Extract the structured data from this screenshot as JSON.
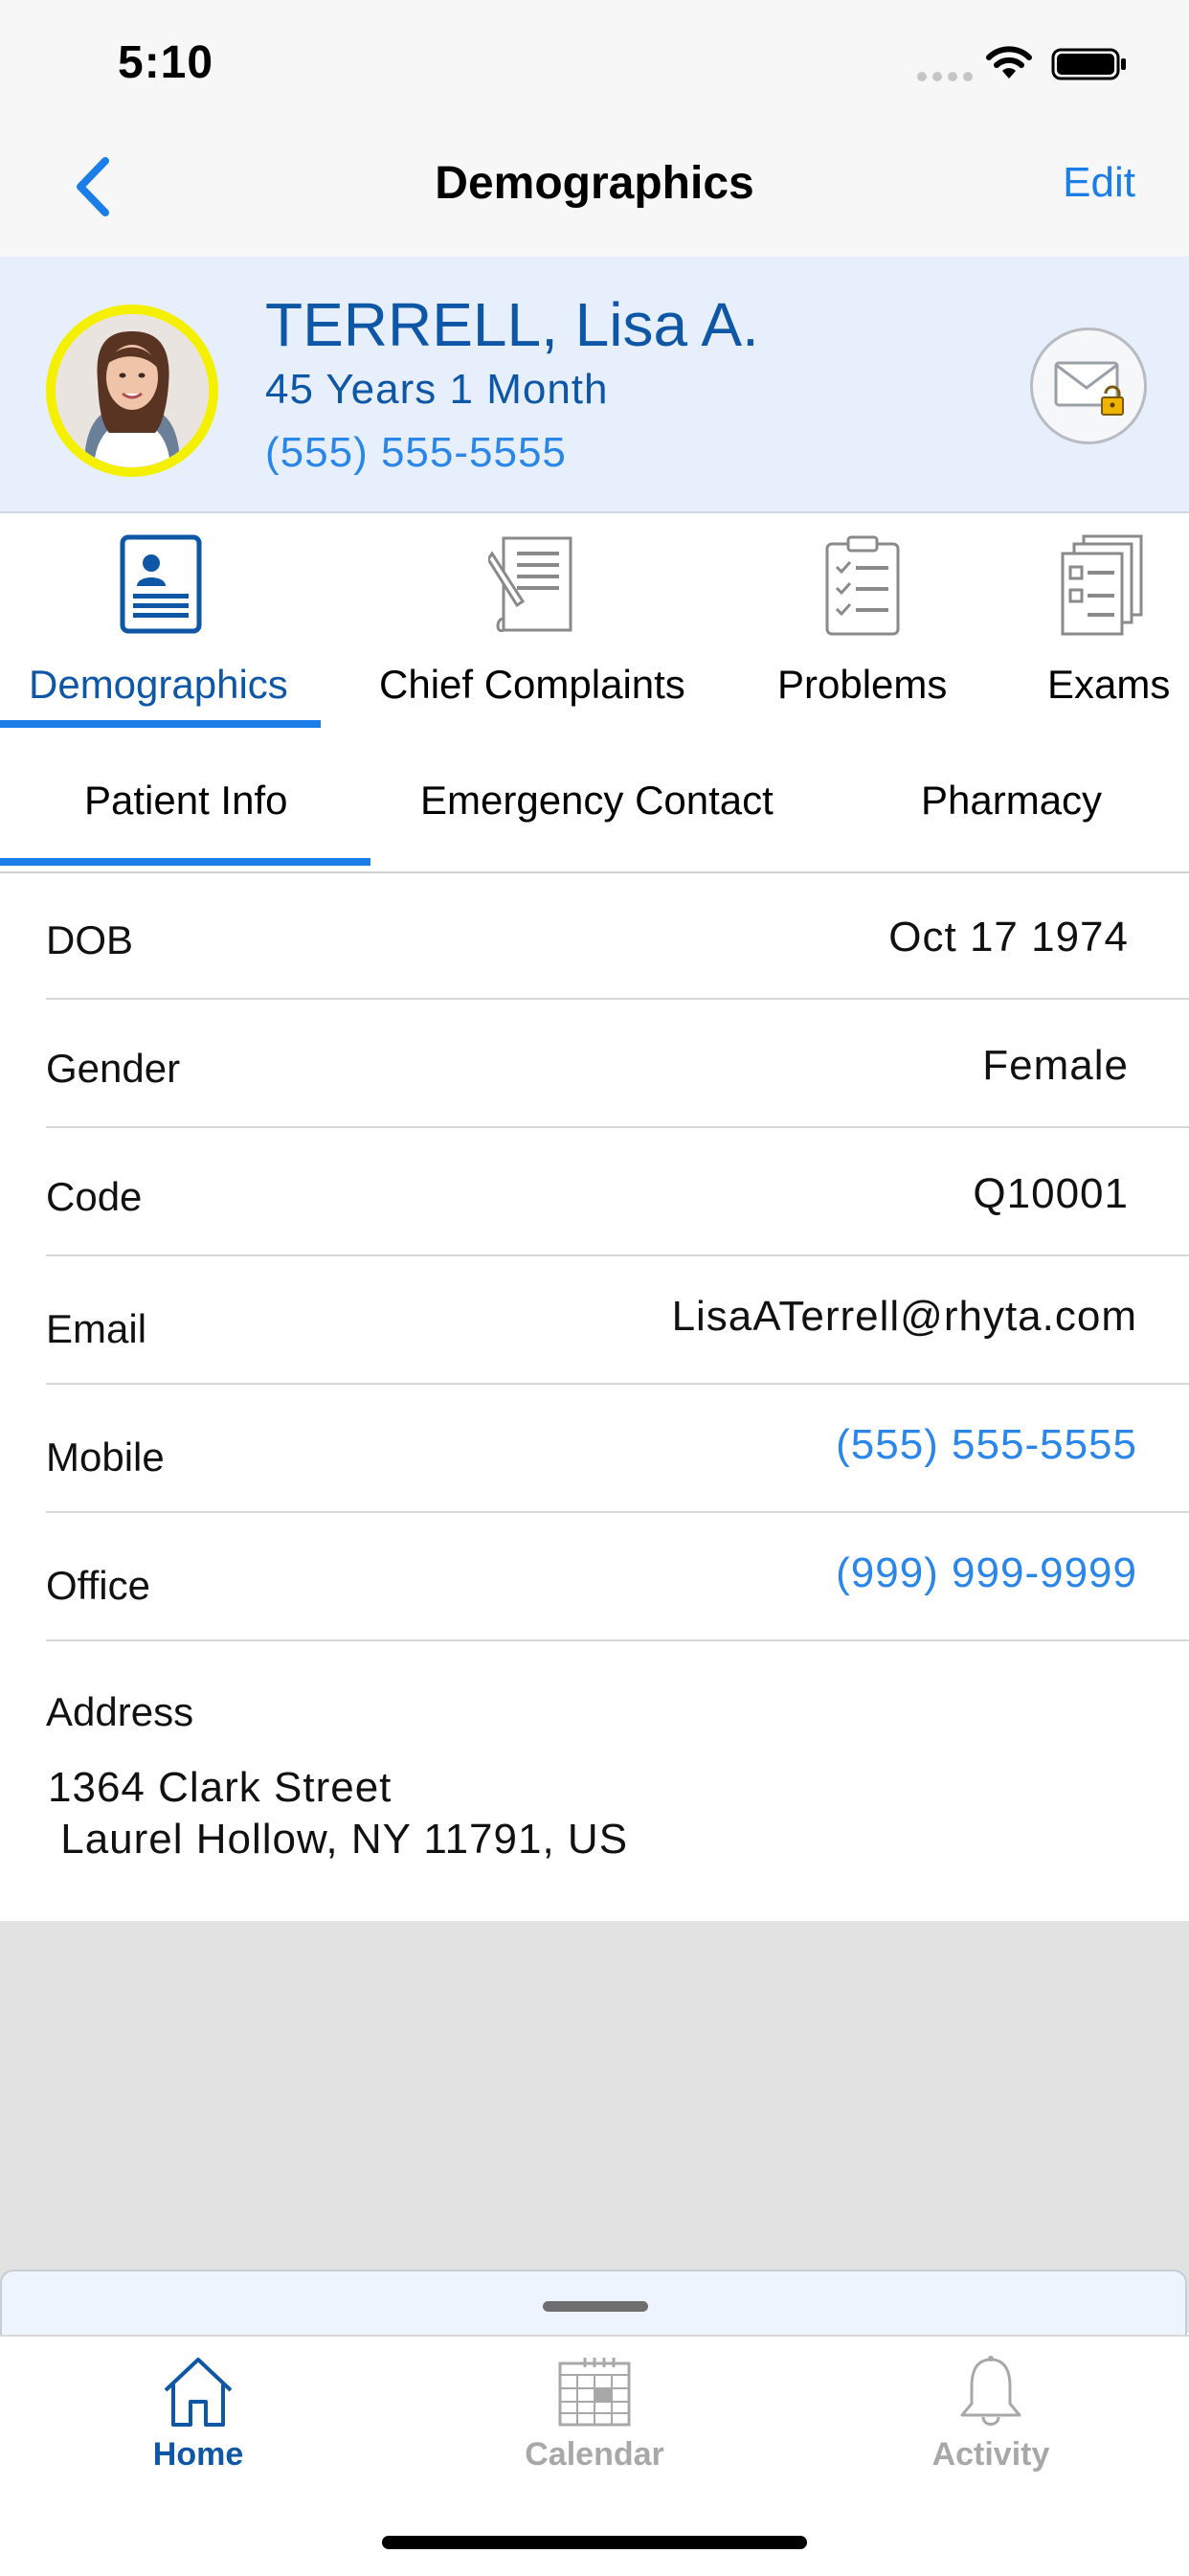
{
  "status_bar": {
    "time": "5:10"
  },
  "nav": {
    "title": "Demographics",
    "edit_label": "Edit"
  },
  "patient": {
    "name": "TERRELL, Lisa A.",
    "age": "45 Years 1 Month",
    "phone": "(555) 555-5555"
  },
  "module_tabs": [
    {
      "label": "Demographics",
      "icon": "id-card-icon",
      "active": true
    },
    {
      "label": "Chief Complaints",
      "icon": "document-pen-icon",
      "active": false
    },
    {
      "label": "Problems",
      "icon": "clipboard-checklist-icon",
      "active": false
    },
    {
      "label": "Exams",
      "icon": "stacked-checklist-icon",
      "active": false
    }
  ],
  "sub_tabs": [
    {
      "label": "Patient Info",
      "active": true
    },
    {
      "label": "Emergency Contact",
      "active": false
    },
    {
      "label": "Pharmacy",
      "active": false
    }
  ],
  "details": {
    "dob": {
      "label": "DOB",
      "value": "Oct 17 1974"
    },
    "gender": {
      "label": "Gender",
      "value": "Female"
    },
    "code": {
      "label": "Code",
      "value": "Q10001"
    },
    "email": {
      "label": "Email",
      "value": "LisaATerrell@rhyta.com"
    },
    "mobile": {
      "label": "Mobile",
      "value": "(555) 555-5555"
    },
    "office": {
      "label": "Office",
      "value": "(999) 999-9999"
    },
    "address": {
      "label": "Address",
      "line1": "1364 Clark Street",
      "line2": " Laurel Hollow, NY 11791, US"
    }
  },
  "tab_bar": [
    {
      "label": "Home",
      "icon": "home-icon",
      "active": true
    },
    {
      "label": "Calendar",
      "icon": "calendar-icon",
      "active": false
    },
    {
      "label": "Activity",
      "icon": "bell-icon",
      "active": false
    }
  ],
  "colors": {
    "accent": "#1a7de8",
    "brand_dark": "#0e56a6",
    "header_bg": "#e6effb",
    "avatar_ring": "#f4f000"
  }
}
